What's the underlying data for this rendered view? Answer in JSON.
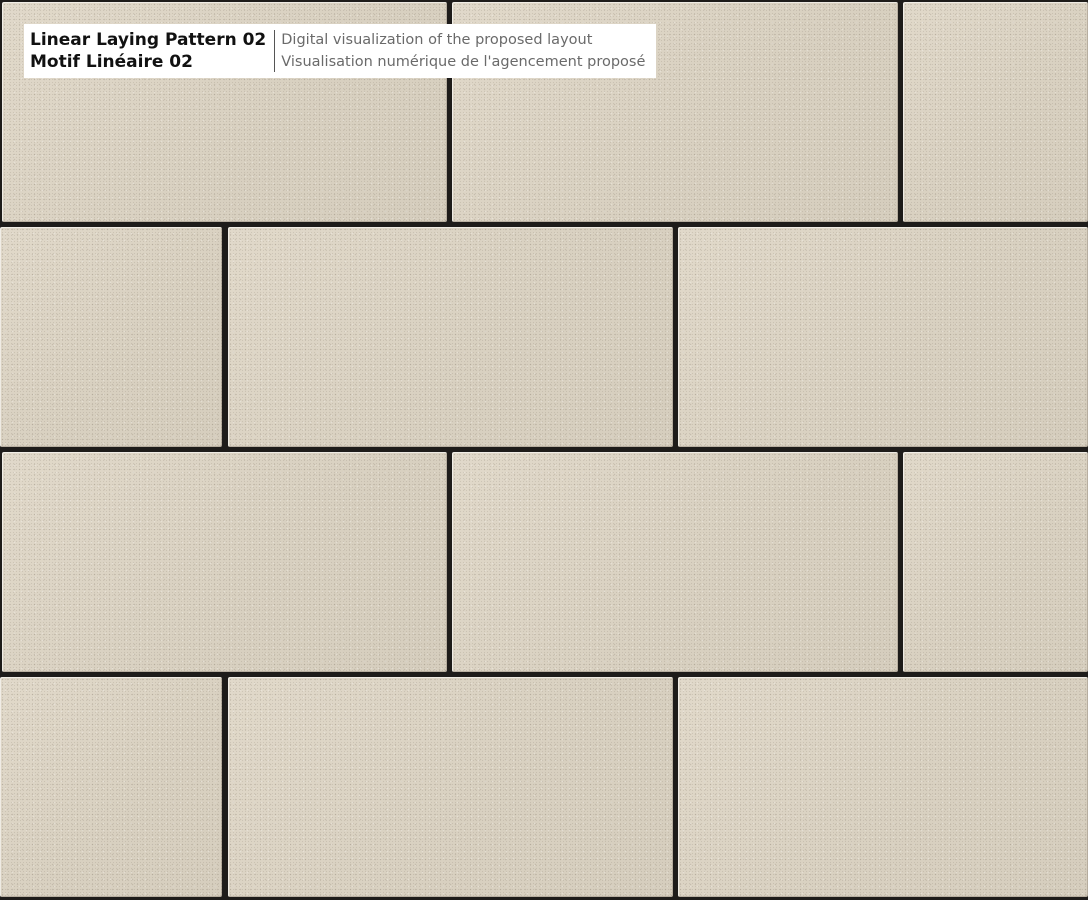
{
  "caption": {
    "title_en": "Linear Laying Pattern 02",
    "title_fr": "Motif Linéaire 02",
    "description_en": "Digital visualization of the proposed layout",
    "description_fr": "Visualisation numérique de l'agencement proposé"
  },
  "colors": {
    "paver": "#dcd4c5",
    "joint": "#1e1c1a",
    "caption_bg": "#ffffff"
  },
  "pattern": {
    "type": "linear running bond",
    "rows": 4
  }
}
